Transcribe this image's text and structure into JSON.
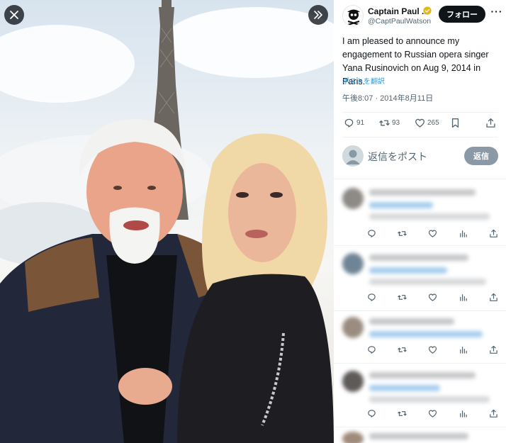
{
  "post": {
    "author_name": "Captain Paul ...",
    "author_handle": "@CaptPaulWatson",
    "follow_label": "フォロー",
    "more_label": "···",
    "text": "I am pleased to announce my engagement to Russian opera singer Yana Rusinovich on Aug 9, 2014 in Paris.",
    "translate_label": "ポストを翻訳",
    "timestamp": "午後8:07 · 2014年8月11日",
    "stats": {
      "replies": "91",
      "reposts": "93",
      "likes": "265"
    }
  },
  "reply_box": {
    "placeholder": "返信をポスト",
    "button_label": "返信"
  },
  "colors": {
    "accent_blue": "#1d9bf0",
    "verified_gold": "#e2b719",
    "text_primary": "#0f1419",
    "text_secondary": "#536471"
  },
  "icons": {
    "close": "close-icon",
    "expand": "chevron-double-right-icon",
    "verified": "verified-badge-icon",
    "reply": "comment-icon",
    "repost": "repost-icon",
    "like": "heart-icon",
    "bookmark": "bookmark-icon",
    "share": "share-icon",
    "views": "bar-chart-icon"
  }
}
